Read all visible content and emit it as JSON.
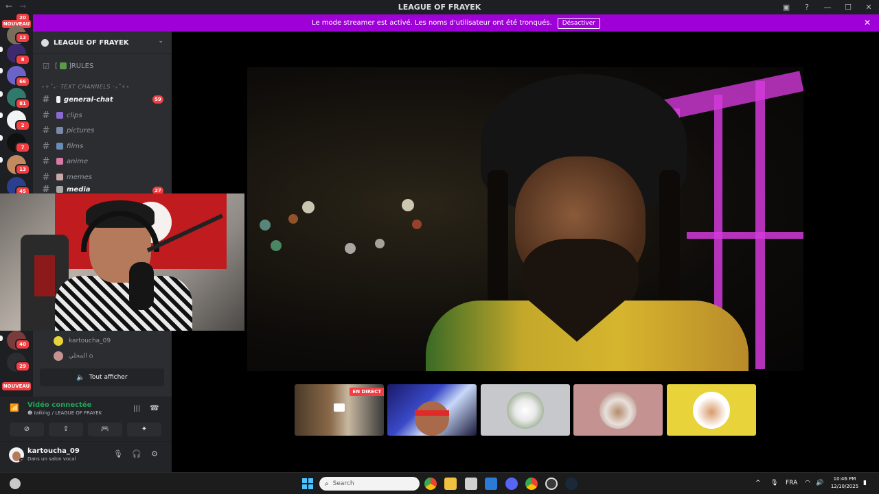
{
  "window": {
    "title": "LEAGUE OF FRAYEK",
    "back_glyph": "←",
    "forward_glyph": "→",
    "icons": [
      "inbox-icon",
      "help-icon",
      "minimize-icon",
      "maximize-icon",
      "close-icon"
    ]
  },
  "banner": {
    "text": "Le mode streamer est activé. Les noms d'utilisateur ont été tronqués.",
    "button": "Désactiver"
  },
  "servers": {
    "badges": [
      "12",
      "8",
      "66",
      "81",
      "2",
      "7",
      "13",
      "45",
      "40",
      "29"
    ],
    "nouveau": "NOUVEAU",
    "top_count": "20"
  },
  "guild": {
    "name": "LEAGUE OF FRAYEK"
  },
  "channels": {
    "rules": "]RULES",
    "rules_prefix": "[",
    "category": "⋆✧˚₊‧ TEXT CHANNELS ‧₊˚✧⋆",
    "items": [
      {
        "name": "general-chat",
        "badge": "59",
        "bold": true
      },
      {
        "name": "clips"
      },
      {
        "name": "pictures"
      },
      {
        "name": "films"
      },
      {
        "name": "anime"
      },
      {
        "name": "memes"
      },
      {
        "name": "media",
        "badge": "27",
        "bold": true
      }
    ]
  },
  "voice_members": [
    {
      "name": "kartoucha_09"
    },
    {
      "name": "⁨المحلي⁩ ⌂"
    }
  ],
  "show_all": "Tout afficher",
  "voice": {
    "state": "Vidéo connectée",
    "channel_prefix": "☻ talking",
    "channel": "/ LEAGUE OF FRAYEK"
  },
  "user": {
    "name": "kartoucha_09",
    "status": "Dans un salon vocal"
  },
  "tiles": {
    "live_label": "EN DIRECT"
  },
  "taskbar": {
    "search_placeholder": "Search",
    "language": "FRA",
    "time": "10:46 PM",
    "date": "12/10/2025"
  },
  "colors": {
    "banner": "#a000d8",
    "mention_red": "#f23f43",
    "connected_green": "#23a55a",
    "tile_yellow": "#e8d43a",
    "tile_rose": "#c49391"
  }
}
